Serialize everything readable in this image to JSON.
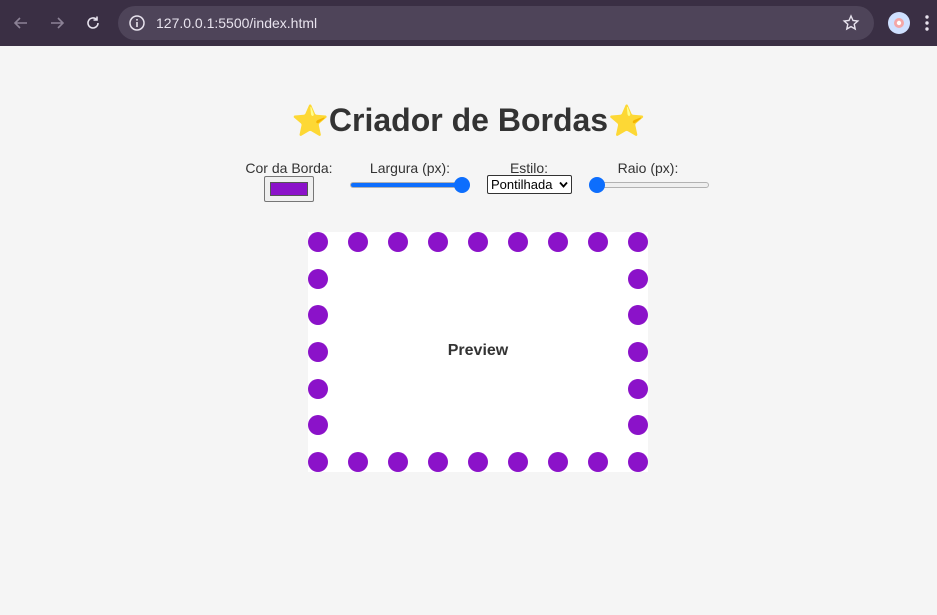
{
  "browser": {
    "url": "127.0.0.1:5500/index.html"
  },
  "page": {
    "title": "Criador de Bordas",
    "title_emoji": "⭐"
  },
  "controls": {
    "color_label": "Cor da Borda:",
    "color_value": "#8b12c9",
    "width_label": "Largura (px):",
    "width_fraction": 1.0,
    "style_label": "Estilo:",
    "style_selected": "Pontilhada",
    "radius_label": "Raio (px):",
    "radius_fraction": 0.0
  },
  "preview": {
    "text": "Preview",
    "border_color": "#8b12c9",
    "border_style": "dotted"
  },
  "colors": {
    "accent": "#0d6efd",
    "chrome": "#3a2f44"
  }
}
